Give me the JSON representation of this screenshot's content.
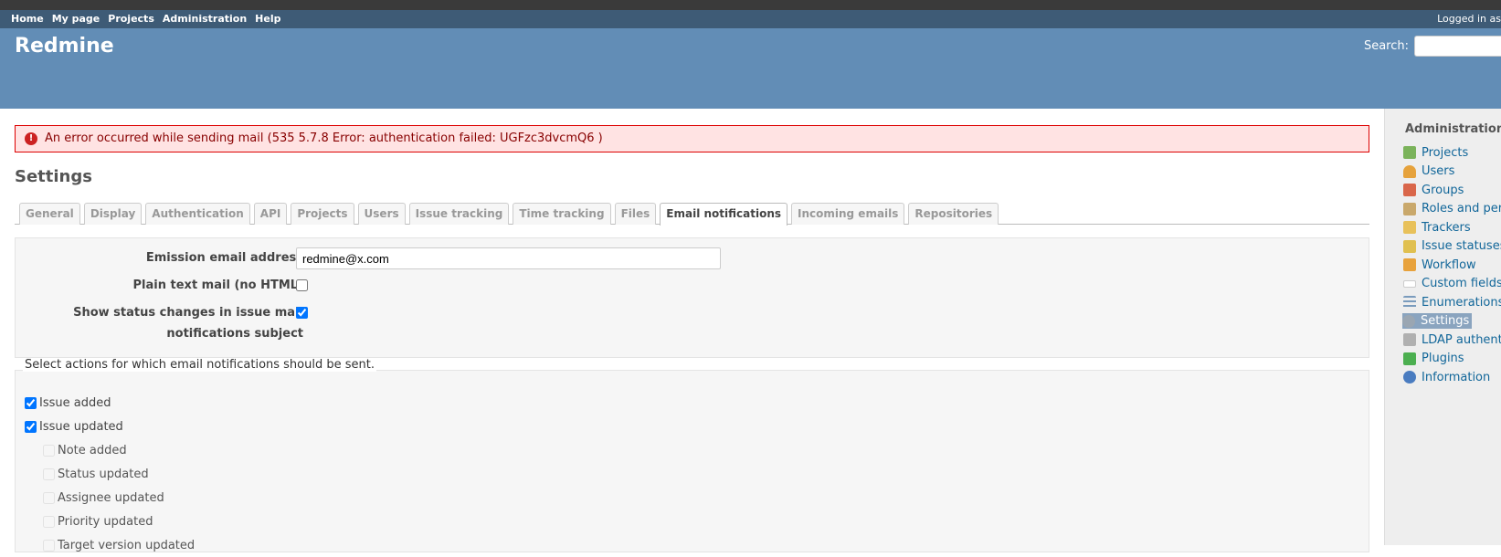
{
  "top_menu": {
    "items": [
      "Home",
      "My page",
      "Projects",
      "Administration",
      "Help"
    ],
    "logged_as": "Logged in as"
  },
  "header": {
    "title": "Redmine",
    "search_label": "Search:",
    "search_value": ""
  },
  "flash": {
    "error": "An error occurred while sending mail (535 5.7.8 Error: authentication failed: UGFzc3dvcmQ6 )"
  },
  "page": {
    "title": "Settings"
  },
  "tabs": [
    "General",
    "Display",
    "Authentication",
    "API",
    "Projects",
    "Users",
    "Issue tracking",
    "Time tracking",
    "Files",
    "Email notifications",
    "Incoming emails",
    "Repositories"
  ],
  "selected_tab": "Email notifications",
  "settings": {
    "emission_label": "Emission email address",
    "emission_value": "redmine@x.com",
    "plain_text_label": "Plain text mail (no HTML)",
    "plain_text_checked": false,
    "status_subject_label_1": "Show status changes in issue mail",
    "status_subject_label_2": "notifications subject",
    "status_subject_checked": true
  },
  "notifications": {
    "legend": "Select actions for which email notifications should be sent.",
    "items": [
      {
        "label": "Issue added",
        "checked": true,
        "sub": false
      },
      {
        "label": "Issue updated",
        "checked": true,
        "sub": false
      },
      {
        "label": "Note added",
        "checked": false,
        "sub": true
      },
      {
        "label": "Status updated",
        "checked": false,
        "sub": true
      },
      {
        "label": "Assignee updated",
        "checked": false,
        "sub": true
      },
      {
        "label": "Priority updated",
        "checked": false,
        "sub": true
      },
      {
        "label": "Target version updated",
        "checked": false,
        "sub": true
      }
    ]
  },
  "sidebar": {
    "title": "Administration",
    "items": [
      {
        "label": "Projects",
        "icon": "projects-icon",
        "color": "#7bb35b"
      },
      {
        "label": "Users",
        "icon": "user-icon",
        "color": "#e6a23c"
      },
      {
        "label": "Groups",
        "icon": "group-icon",
        "color": "#d9664a"
      },
      {
        "label": "Roles and permissions",
        "icon": "roles-icon",
        "color": "#c9a86b"
      },
      {
        "label": "Trackers",
        "icon": "trackers-icon",
        "color": "#e8c15a"
      },
      {
        "label": "Issue statuses",
        "icon": "issue-statuses-icon",
        "color": "#e0c050"
      },
      {
        "label": "Workflow",
        "icon": "workflow-icon",
        "color": "#e8a23c"
      },
      {
        "label": "Custom fields",
        "icon": "custom-fields-icon",
        "color": "#ffffff"
      },
      {
        "label": "Enumerations",
        "icon": "enumerations-icon",
        "color": "#7a9bbd"
      },
      {
        "label": "Settings",
        "icon": "gear-icon",
        "color": "#9aa6b2",
        "selected": true
      },
      {
        "label": "LDAP authentication",
        "icon": "ldap-icon",
        "color": "#b0b0b0"
      },
      {
        "label": "Plugins",
        "icon": "plugin-icon",
        "color": "#4caf50"
      },
      {
        "label": "Information",
        "icon": "info-icon",
        "color": "#4a7cc0"
      }
    ]
  }
}
